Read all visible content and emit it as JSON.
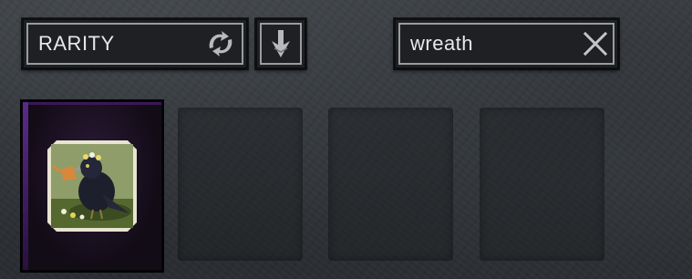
{
  "sort": {
    "label": "RARITY"
  },
  "search": {
    "value": "wreath"
  },
  "icons": {
    "sort_swap": "swap-arrows-icon",
    "sort_direction": "down-arrow-icon",
    "clear": "close-x-icon"
  },
  "results": {
    "items": [
      {
        "name": "crow-watering-can-portrait",
        "rarity_color": "#5a2a8a"
      }
    ],
    "empty_slots": 3
  }
}
